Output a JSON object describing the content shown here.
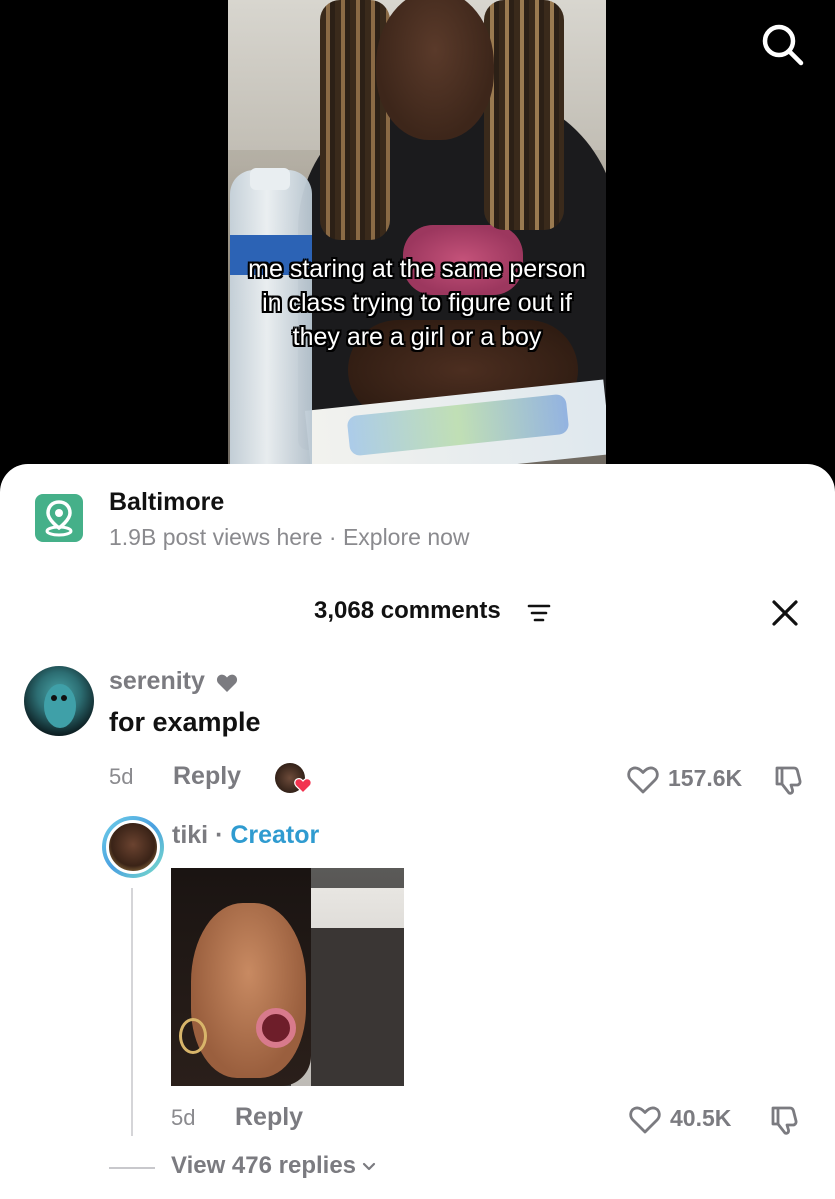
{
  "video": {
    "caption": "me staring at the same person in class trying to figure out if they are a girl or a boy"
  },
  "icons": {
    "search": "search-icon",
    "location": "map-pin-icon",
    "filter": "filter-icon",
    "close": "close-icon",
    "heart": "heart-icon",
    "dislike": "thumbs-down-icon",
    "chevron": "chevron-down-icon"
  },
  "location": {
    "title": "Baltimore",
    "subtitle": "1.9B post views here · Explore now"
  },
  "comments_header": {
    "title": "3,068 comments"
  },
  "comments": [
    {
      "username": "serenity",
      "text": "for example",
      "age": "5d",
      "reply_label": "Reply",
      "likes": "157.6K"
    }
  ],
  "reply": {
    "username": "tiki",
    "separator": " · ",
    "badge": "Creator",
    "age": "5d",
    "reply_label": "Reply",
    "likes": "40.5K",
    "view_replies": "View 476 replies"
  },
  "colors": {
    "location_icon_bg": "#45b089",
    "creator_badge": "#2f9bd0",
    "heart_red": "#f2334f",
    "muted_text": "#7b7b80"
  }
}
